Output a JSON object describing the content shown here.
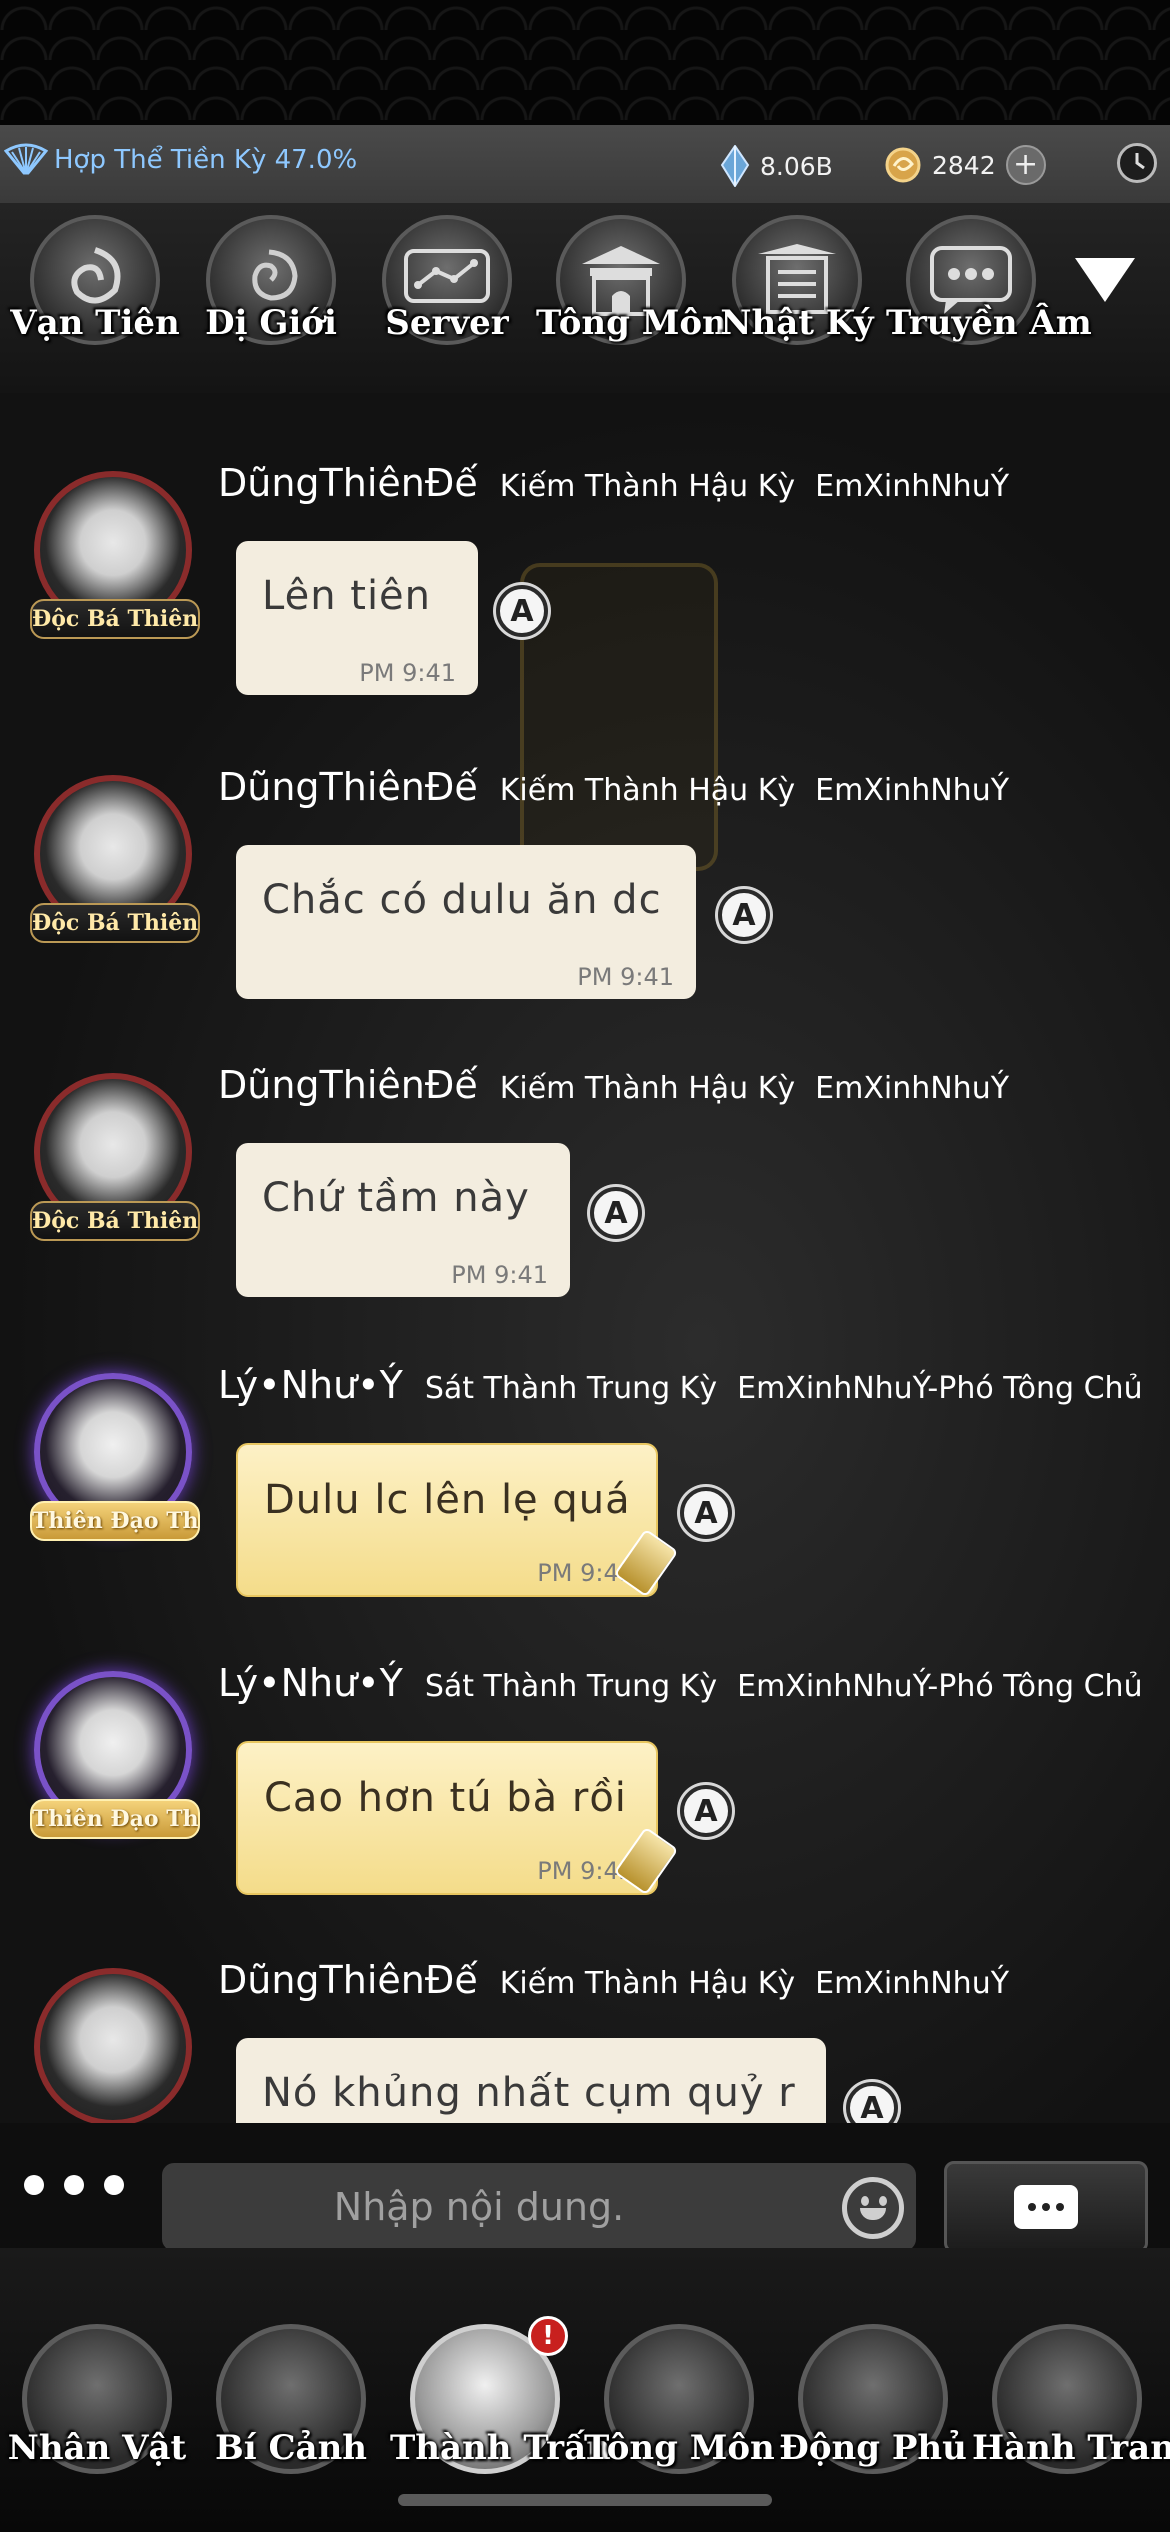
{
  "status": {
    "realm_label": "Hợp Thể Tiền Kỳ 47.0%",
    "crystal_amount": "8.06B",
    "coin_amount": "2842",
    "plus_symbol": "+",
    "accent_color": "#8ec8ff"
  },
  "top_tabs": [
    {
      "label": "Vạn Tiên",
      "icon": "vortex-icon"
    },
    {
      "label": "Dị Giới",
      "icon": "spiral-icon"
    },
    {
      "label": "Server",
      "icon": "chat-graph-icon"
    },
    {
      "label": "Tông Môn",
      "icon": "temple-icon"
    },
    {
      "label": "Nhật Ký",
      "icon": "journal-icon"
    },
    {
      "label": "Truyền Âm",
      "icon": "message-bubble-icon"
    }
  ],
  "messages": [
    {
      "sender": "DũngThiênĐế",
      "realm": "Kiếm Thành Hậu Kỳ",
      "guild": "EmXinhNhuÝ",
      "title": "Độc Bá Thiên Hạ",
      "text": "Lên tiên",
      "time": "PM 9:41",
      "style": "white"
    },
    {
      "sender": "DũngThiênĐế",
      "realm": "Kiếm Thành Hậu Kỳ",
      "guild": "EmXinhNhuÝ",
      "title": "Độc Bá Thiên Hạ",
      "text": "Chắc có dulu ăn dc",
      "time": "PM 9:41",
      "style": "white"
    },
    {
      "sender": "DũngThiênĐế",
      "realm": "Kiếm Thành Hậu Kỳ",
      "guild": "EmXinhNhuÝ",
      "title": "Độc Bá Thiên Hạ",
      "text": "Chứ tầm này",
      "time": "PM 9:41",
      "style": "white"
    },
    {
      "sender": "Lý•Như•Ý",
      "realm": "Sát Thành Trung Kỳ",
      "guild": "EmXinhNhuÝ-Phó Tông Chủ",
      "title": "Thiên Đạo Thánh Quân",
      "text": "Dulu lc lên lẹ quá",
      "time": "PM 9:41",
      "style": "gold"
    },
    {
      "sender": "Lý•Như•Ý",
      "realm": "Sát Thành Trung Kỳ",
      "guild": "EmXinhNhuÝ-Phó Tông Chủ",
      "title": "Thiên Đạo Thánh Quân",
      "text": "Cao hơn tú bà rồi",
      "time": "PM 9:42",
      "style": "gold"
    },
    {
      "sender": "DũngThiênĐế",
      "realm": "Kiếm Thành Hậu Kỳ",
      "guild": "EmXinhNhuÝ",
      "title": "",
      "text": "Nó khủng nhất cụm quỷ r",
      "time": "",
      "style": "white"
    }
  ],
  "a_badge": "A",
  "input": {
    "placeholder": "Nhập nội dung."
  },
  "bottom_nav": [
    {
      "label": "Nhân Vật"
    },
    {
      "label": "Bí Cảnh"
    },
    {
      "label": "Thành Trấn",
      "badge": "!"
    },
    {
      "label": "Tông Môn"
    },
    {
      "label": "Động Phủ"
    },
    {
      "label": "Hành Trang"
    }
  ]
}
